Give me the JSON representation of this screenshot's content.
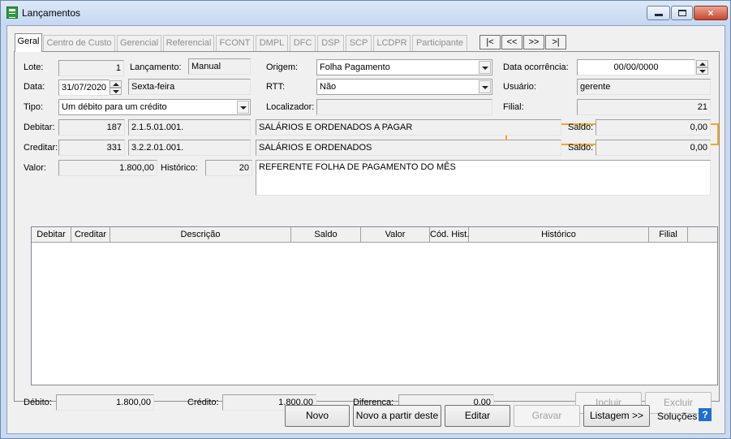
{
  "window": {
    "title": "Lançamentos",
    "close_label": "×"
  },
  "tabs": [
    {
      "label": "Geral"
    },
    {
      "label": "Centro de Custo"
    },
    {
      "label": "Gerencial"
    },
    {
      "label": "Referencial"
    },
    {
      "label": "FCONT"
    },
    {
      "label": "DMPL"
    },
    {
      "label": "DFC"
    },
    {
      "label": "DSP"
    },
    {
      "label": "SCP"
    },
    {
      "label": "LCDPR"
    },
    {
      "label": "Participante"
    }
  ],
  "nav": {
    "first": "|<",
    "prev": "<<",
    "next": ">>",
    "last": ">|"
  },
  "form": {
    "lote_label": "Lote:",
    "lote": "1",
    "lancamento_label": "Lançamento:",
    "lancamento": "Manual",
    "origem_label": "Origem:",
    "origem": "Folha Pagamento",
    "data_ocorrencia_label": "Data ocorrência:",
    "data_ocorrencia": "00/00/0000",
    "data_label": "Data:",
    "data": "31/07/2020",
    "dia_semana": "Sexta-feira",
    "rtt_label": "RTT:",
    "rtt": "Não",
    "usuario_label": "Usuário:",
    "usuario": "gerente",
    "tipo_label": "Tipo:",
    "tipo": "Um débito para um crédito",
    "localizador_label": "Localizador:",
    "localizador": "",
    "filial_label": "Filial:",
    "filial": "21",
    "debitar_label": "Debitar:",
    "debitar_codigo": "187",
    "debitar_conta": "2.1.5.01.001.",
    "debitar_descricao": "SALÁRIOS E ORDENADOS A PAGAR",
    "saldo_label": "Saldo:",
    "debitar_saldo": "0,00",
    "creditar_label": "Creditar:",
    "creditar_codigo": "331",
    "creditar_conta": "3.2.2.01.001.",
    "creditar_descricao": "SALÁRIOS E ORDENADOS",
    "creditar_saldo": "0,00",
    "valor_label": "Valor:",
    "valor": "1.800,00",
    "historico_label": "Histórico:",
    "historico_codigo": "20",
    "historico_texto": "REFERENTE FOLHA DE PAGAMENTO DO MÊS"
  },
  "grid": {
    "columns": [
      "Debitar",
      "Creditar",
      "Descrição",
      "Saldo",
      "Valor",
      "Cód. Hist.",
      "Histórico",
      "Filial"
    ],
    "rows": []
  },
  "totals": {
    "debito_label": "Débito:",
    "debito": "1.800,00",
    "credito_label": "Crédito:",
    "credito": "1.800,00",
    "diferenca_label": "Diferença:",
    "diferenca": "0,00"
  },
  "buttons": {
    "incluir": "Incluir",
    "excluir": "Excluir",
    "novo": "Novo",
    "novo_partir": "Novo a partir deste",
    "editar": "Editar",
    "gravar": "Gravar",
    "listagem": "Listagem >>",
    "solucoes": "Soluções",
    "help": "?"
  }
}
